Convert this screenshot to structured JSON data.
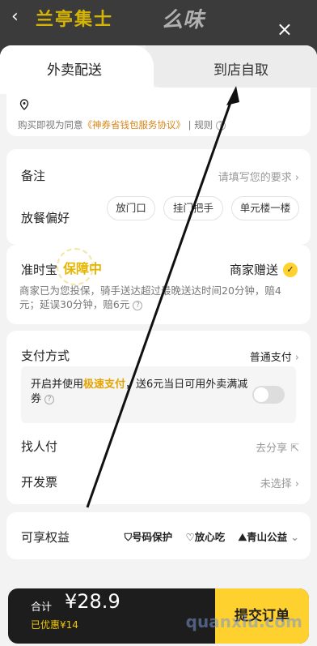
{
  "header": {
    "back_icon": "chevron-left-icon",
    "brand_text": "兰亭集士",
    "brand2_text": "么味",
    "close_label": "×"
  },
  "tabs": [
    {
      "label": "外卖配送",
      "active": true
    },
    {
      "label": "到店自取",
      "active": false
    }
  ],
  "address": {
    "pin_icon": "location-pin-icon",
    "agreement_prefix": "购买即视为同意",
    "agreement_link": "《神券省钱包服务协议》",
    "agreement_suffix": "规则"
  },
  "notes": {
    "label": "备注",
    "placeholder": "请填写您的要求",
    "preference_label": "放餐偏好",
    "chips": [
      "放门口",
      "挂门把手",
      "单元楼一楼"
    ]
  },
  "ontime": {
    "label": "准时宝",
    "badge": "保障中",
    "gift": "商家赠送",
    "description": "商家已为您投保，骑手送达超过最晚送达时间20分钟，赔4元；延误30分钟，赔6元"
  },
  "payment": {
    "label": "支付方式",
    "value": "普通支付",
    "promo_prefix": "开启并使用",
    "promo_highlight": "极速支付",
    "promo_suffix": "，送6元当日可用外卖满减券",
    "payer_label": "找人付",
    "payer_value": "去分享",
    "invoice_label": "开发票",
    "invoice_value": "未选择"
  },
  "rights": {
    "label": "可享权益",
    "items": [
      "号码保护",
      "放心吃",
      "青山公益"
    ]
  },
  "footer": {
    "total_label": "合计",
    "price": "¥28.9",
    "saved": "已优惠¥14",
    "submit_label": "提交订单"
  },
  "watermark": "quanxiu.com",
  "colors": {
    "accent": "#ffd12e",
    "link": "#d8871a",
    "highlight": "#e6a300",
    "dark_bar": "#1d1d1d"
  }
}
